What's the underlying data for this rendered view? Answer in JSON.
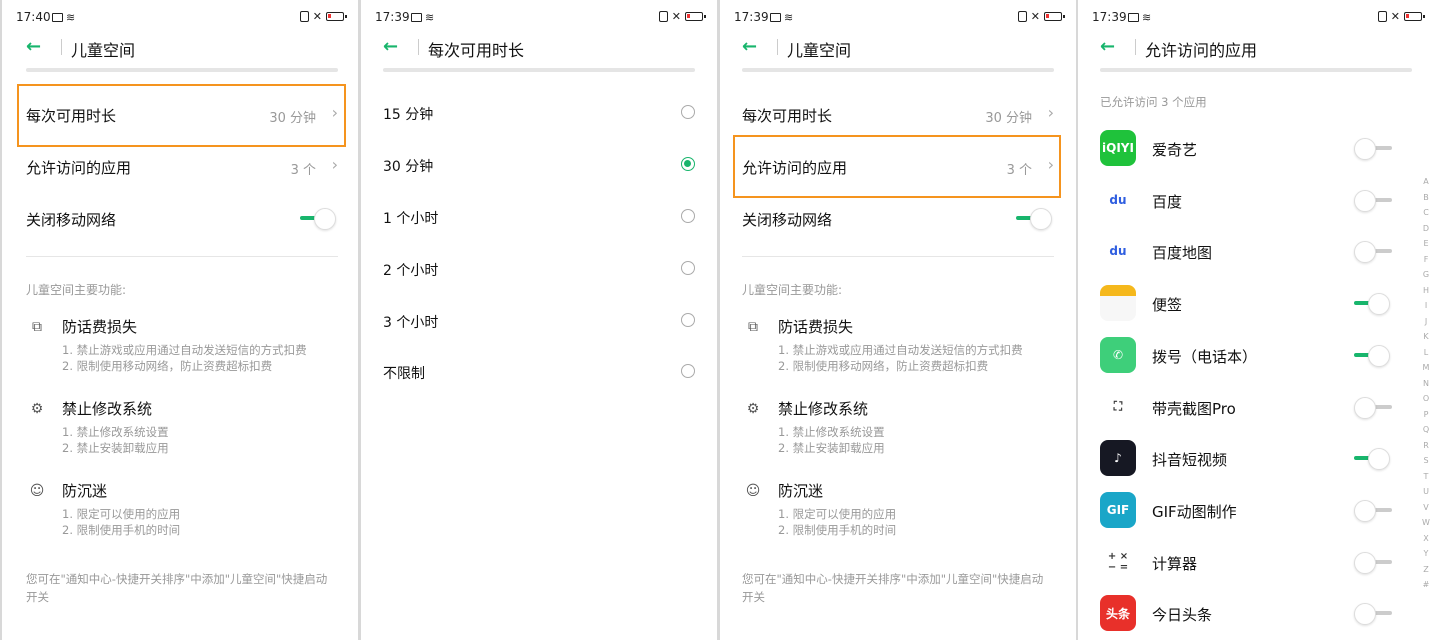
{
  "screens": [
    {
      "time": "17:40",
      "title": "儿童空间",
      "rows": [
        {
          "label": "每次可用时长",
          "value": "30 分钟"
        },
        {
          "label": "允许访问的应用",
          "value": "3 个"
        },
        {
          "label": "关闭移动网络"
        }
      ],
      "section_title": "儿童空间主要功能:",
      "features": [
        {
          "title": "防话费损失",
          "l1": "1. 禁止游戏或应用通过自动发送短信的方式扣费",
          "l2": "2. 限制使用移动网络，防止资费超标扣费"
        },
        {
          "title": "禁止修改系统",
          "l1": "1. 禁止修改系统设置",
          "l2": "2. 禁止安装卸载应用"
        },
        {
          "title": "防沉迷",
          "l1": "1. 限定可以使用的应用",
          "l2": "2. 限制使用手机的时间"
        }
      ],
      "footer": "您可在\"通知中心-快捷开关排序\"中添加\"儿童空间\"快捷启动开关"
    },
    {
      "time": "17:39",
      "title": "每次可用时长",
      "options": [
        "15 分钟",
        "30 分钟",
        "1 个小时",
        "2 个小时",
        "3 个小时",
        "不限制"
      ],
      "selected_index": 1
    },
    {
      "time": "17:39",
      "title": "儿童空间",
      "rows": [
        {
          "label": "每次可用时长",
          "value": "30 分钟"
        },
        {
          "label": "允许访问的应用",
          "value": "3 个"
        },
        {
          "label": "关闭移动网络"
        }
      ],
      "section_title": "儿童空间主要功能:",
      "features": [
        {
          "title": "防话费损失",
          "l1": "1. 禁止游戏或应用通过自动发送短信的方式扣费",
          "l2": "2. 限制使用移动网络，防止资费超标扣费"
        },
        {
          "title": "禁止修改系统",
          "l1": "1. 禁止修改系统设置",
          "l2": "2. 禁止安装卸载应用"
        },
        {
          "title": "防沉迷",
          "l1": "1. 限定可以使用的应用",
          "l2": "2. 限制使用手机的时间"
        }
      ],
      "footer": "您可在\"通知中心-快捷开关排序\"中添加\"儿童空间\"快捷启动开关"
    },
    {
      "time": "17:39",
      "title": "允许访问的应用",
      "allowed_count": "已允许访问 3 个应用",
      "apps": [
        {
          "name": "爱奇艺",
          "on": false,
          "icon_text": "iQIYI",
          "color": "#1fc23b"
        },
        {
          "name": "百度",
          "on": false,
          "icon_text": "du",
          "color": "#ffffff"
        },
        {
          "name": "百度地图",
          "on": false,
          "icon_text": "du",
          "color": "#ffffff"
        },
        {
          "name": "便签",
          "on": true,
          "icon_text": "",
          "color": "#f5b81c"
        },
        {
          "name": "拨号（电话本）",
          "on": true,
          "icon_text": "✆",
          "color": "#3ecf7a"
        },
        {
          "name": "带壳截图Pro",
          "on": false,
          "icon_text": "⛶",
          "color": "#ffffff"
        },
        {
          "name": "抖音短视频",
          "on": true,
          "icon_text": "♪",
          "color": "#161823"
        },
        {
          "name": "GIF动图制作",
          "on": false,
          "icon_text": "GIF",
          "color": "#1aa6c8"
        },
        {
          "name": "计算器",
          "on": false,
          "icon_text": "+ ×\n− =",
          "color": "#ffffff"
        },
        {
          "name": "今日头条",
          "on": false,
          "icon_text": "头条",
          "color": "#ffffff"
        }
      ],
      "alphabet": [
        "A",
        "B",
        "C",
        "D",
        "E",
        "F",
        "G",
        "H",
        "I",
        "J",
        "K",
        "L",
        "M",
        "N",
        "O",
        "P",
        "Q",
        "R",
        "S",
        "T",
        "U",
        "V",
        "W",
        "X",
        "Y",
        "Z",
        "#"
      ]
    }
  ],
  "colors": {
    "accent": "#18b56c",
    "highlight": "#f5941e"
  }
}
